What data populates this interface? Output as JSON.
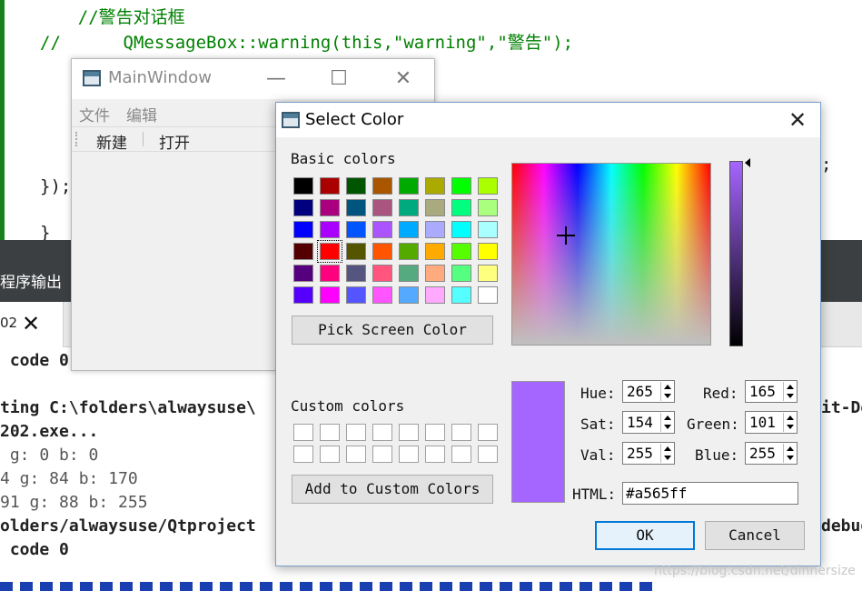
{
  "editor": {
    "lines": [
      "    //警告对话框",
      "//      QMessageBox::warning(this,\"warning\",\"警告\");",
      "});",
      "}",
      ";"
    ]
  },
  "output_panel": {
    "title": "程序输出",
    "tab_label": "02",
    "lines": [
      " code 0",
      "ting C:\\folders\\alwaysuse\\",
      "202.exe...",
      " g: 0 b: 0",
      "4 g: 84 b: 170",
      "91 g: 88 b: 255",
      "olders/alwaysuse/Qtproject",
      " code 0"
    ],
    "right_fragments": [
      "it-De",
      "debug"
    ]
  },
  "main_window": {
    "title": "MainWindow",
    "menu": [
      "文件",
      "编辑"
    ],
    "toolbar": [
      "新建",
      "打开"
    ],
    "controls": {
      "minimize": "—",
      "maximize": "☐",
      "close": "✕"
    }
  },
  "color_dialog": {
    "title": "Select Color",
    "close_glyph": "✕",
    "basic_colors_label": "Basic colors",
    "basic_colors": [
      [
        "#000000",
        "#aa0000",
        "#005500",
        "#aa5500",
        "#00aa00",
        "#aaaa00",
        "#00ff00",
        "#aaff00"
      ],
      [
        "#00007f",
        "#aa007f",
        "#00557f",
        "#aa557f",
        "#00aa7f",
        "#aaaa7f",
        "#00ff7f",
        "#aaff7f"
      ],
      [
        "#0000ff",
        "#aa00ff",
        "#0055ff",
        "#aa55ff",
        "#00aaff",
        "#aaaaff",
        "#00ffff",
        "#aaffff"
      ],
      [
        "#550000",
        "#ff0000",
        "#555500",
        "#ff5500",
        "#55aa00",
        "#ffaa00",
        "#55ff00",
        "#ffff00"
      ],
      [
        "#55007f",
        "#ff007f",
        "#55557f",
        "#ff557f",
        "#55aa7f",
        "#ffaa7f",
        "#55ff7f",
        "#ffff7f"
      ],
      [
        "#5500ff",
        "#ff00ff",
        "#5555ff",
        "#ff55ff",
        "#55aaff",
        "#ffaaff",
        "#55ffff",
        "#ffffff"
      ]
    ],
    "selected_basic": "#ff0000",
    "pick_screen_label": "Pick Screen Color",
    "custom_colors_label": "Custom colors",
    "add_custom_label": "Add to Custom Colors",
    "fields": {
      "hue": {
        "label": "Hue:",
        "value": "265"
      },
      "sat": {
        "label": "Sat:",
        "value": "154"
      },
      "val": {
        "label": "Val:",
        "value": "255"
      },
      "red": {
        "label": "Red:",
        "value": "165"
      },
      "green": {
        "label": "Green:",
        "value": "101"
      },
      "blue": {
        "label": "Blue:",
        "value": "255"
      }
    },
    "html_label": "HTML:",
    "html_value": "#a565ff",
    "current_color": "#a565ff",
    "ok_label": "OK",
    "cancel_label": "Cancel"
  },
  "watermark": "https://blog.csdn.net/dinnersize"
}
